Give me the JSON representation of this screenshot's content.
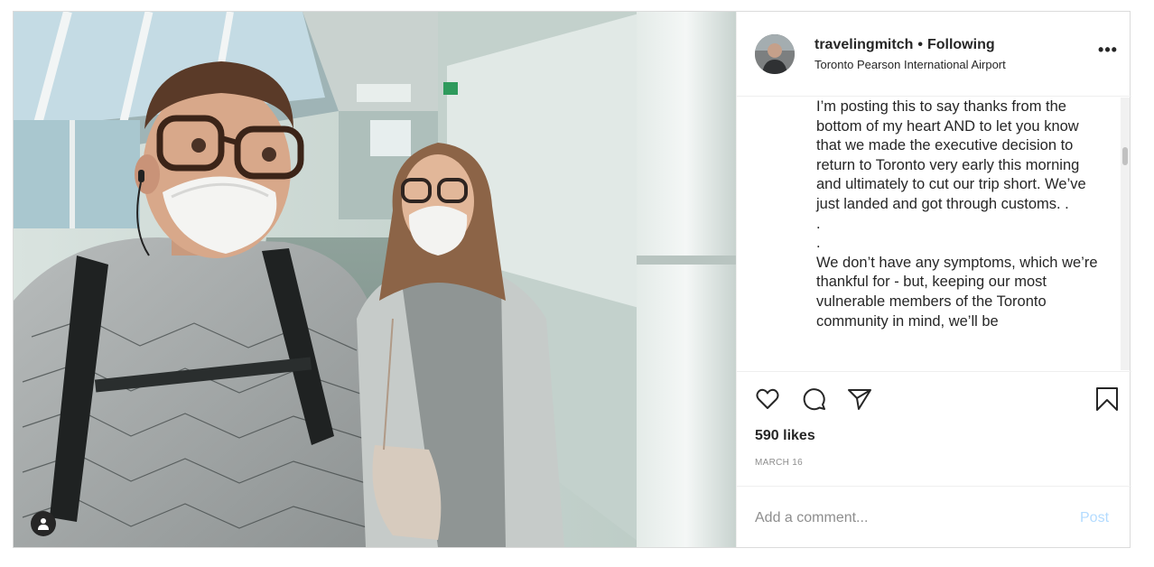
{
  "post": {
    "username": "travelingmitch",
    "separator": "•",
    "follow_status": "Following",
    "location": "Toronto Pearson International Airport",
    "more_label": "•••",
    "caption": "I’m posting this to say thanks from the bottom of my heart AND to let you know that we made the executive decision to return to Toronto very early this morning and ultimately to cut our trip short. We’ve just landed and got through customs. .\n.\n.\nWe don’t have any symptoms, which we’re thankful for - but, keeping our most vulnerable members of the Toronto community in mind, we’ll be",
    "likes": "590 likes",
    "date": "MARCH 16"
  },
  "comment": {
    "placeholder": "Add a comment...",
    "post_label": "Post"
  },
  "icons": {
    "like": "heart-icon",
    "comment": "speech-bubble-icon",
    "share": "paper-plane-icon",
    "save": "bookmark-icon",
    "user_tag": "person-icon"
  },
  "colors": {
    "text": "#262626",
    "secondary_text": "#8e8e8e",
    "border": "#dbdbdb",
    "post_button_disabled": "#b3dbff"
  }
}
